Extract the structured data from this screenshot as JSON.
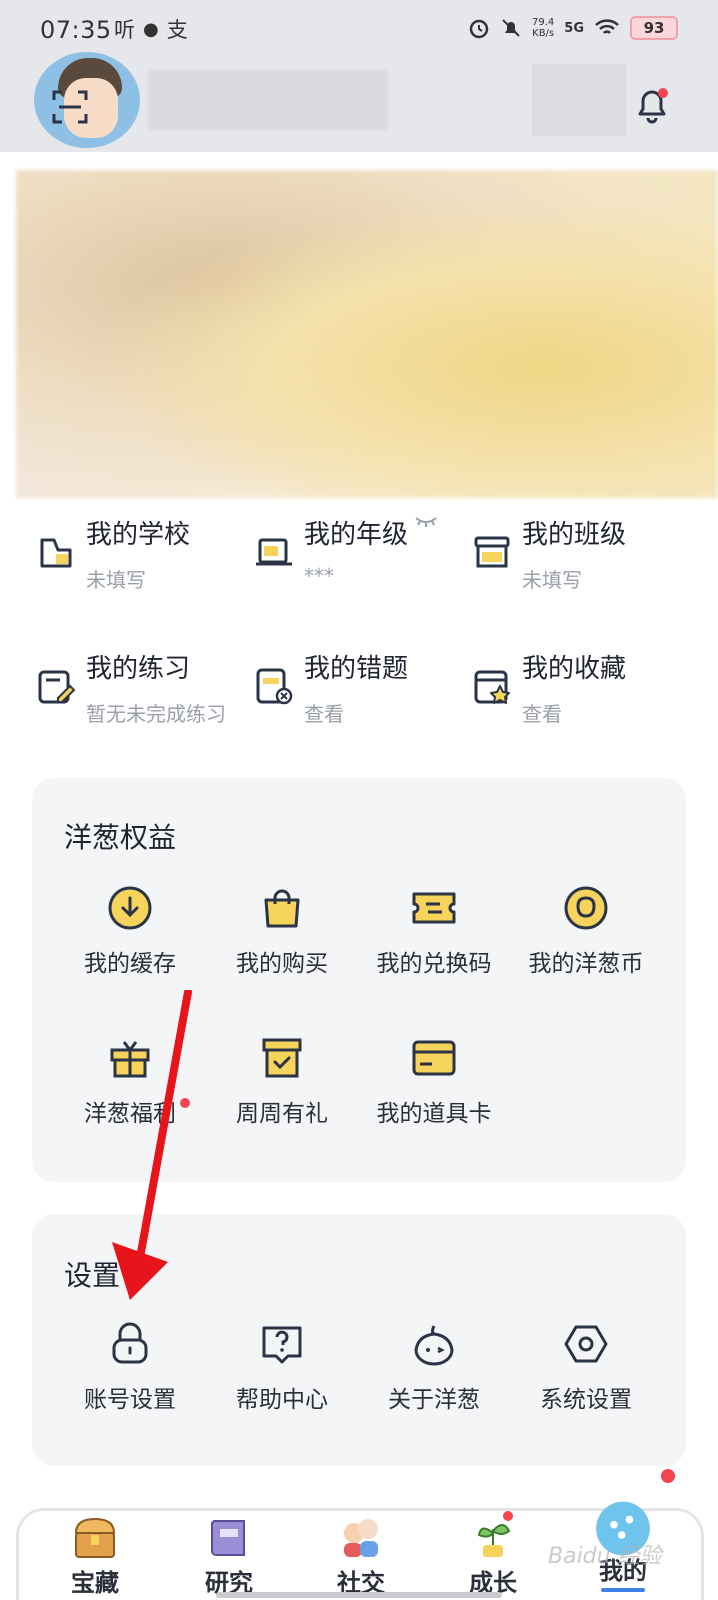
{
  "status_bar": {
    "time": "07:35",
    "left_icons": [
      "听",
      "💬",
      "支"
    ],
    "speed_value": "79.4",
    "speed_unit": "KB/s",
    "network": "5G",
    "battery": "93"
  },
  "info_items": [
    {
      "title": "我的学校",
      "sub": "未填写",
      "icon": "school-icon"
    },
    {
      "title": "我的年级",
      "sub": "***",
      "icon": "grade-icon"
    },
    {
      "title": "我的班级",
      "sub": "未填写",
      "icon": "class-icon"
    },
    {
      "title": "我的练习",
      "sub": "暂无未完成练习",
      "icon": "practice-icon"
    },
    {
      "title": "我的错题",
      "sub": "查看",
      "icon": "mistakes-icon"
    },
    {
      "title": "我的收藏",
      "sub": "查看",
      "icon": "favorites-icon"
    }
  ],
  "benefits": {
    "title": "洋葱权益",
    "items": [
      {
        "label": "我的缓存",
        "icon": "download-icon"
      },
      {
        "label": "我的购买",
        "icon": "shopping-bag-icon"
      },
      {
        "label": "我的兑换码",
        "icon": "ticket-icon"
      },
      {
        "label": "我的洋葱币",
        "icon": "coin-icon"
      },
      {
        "label": "洋葱福利",
        "icon": "gift-icon"
      },
      {
        "label": "周周有礼",
        "icon": "gift-box-icon"
      },
      {
        "label": "我的道具卡",
        "icon": "card-icon"
      }
    ]
  },
  "settings": {
    "title": "设置",
    "items": [
      {
        "label": "账号设置",
        "icon": "lock-icon"
      },
      {
        "label": "帮助中心",
        "icon": "help-icon"
      },
      {
        "label": "关于洋葱",
        "icon": "onion-face-icon"
      },
      {
        "label": "系统设置",
        "icon": "settings-icon"
      }
    ]
  },
  "tabs": [
    {
      "label": "宝藏",
      "icon": "treasure-chest-icon"
    },
    {
      "label": "研究",
      "icon": "book-icon"
    },
    {
      "label": "社交",
      "icon": "friends-icon"
    },
    {
      "label": "成长",
      "icon": "plant-icon"
    },
    {
      "label": "我的",
      "icon": "mascot-icon",
      "active": true
    }
  ],
  "watermark": "Baidu 经验",
  "colors": {
    "accent_yellow": "#f6d35b",
    "icon_stroke": "#2b3346",
    "badge_red": "#f5454f",
    "arrow_red": "#e8141c",
    "card_bg": "#f4f5f7"
  }
}
